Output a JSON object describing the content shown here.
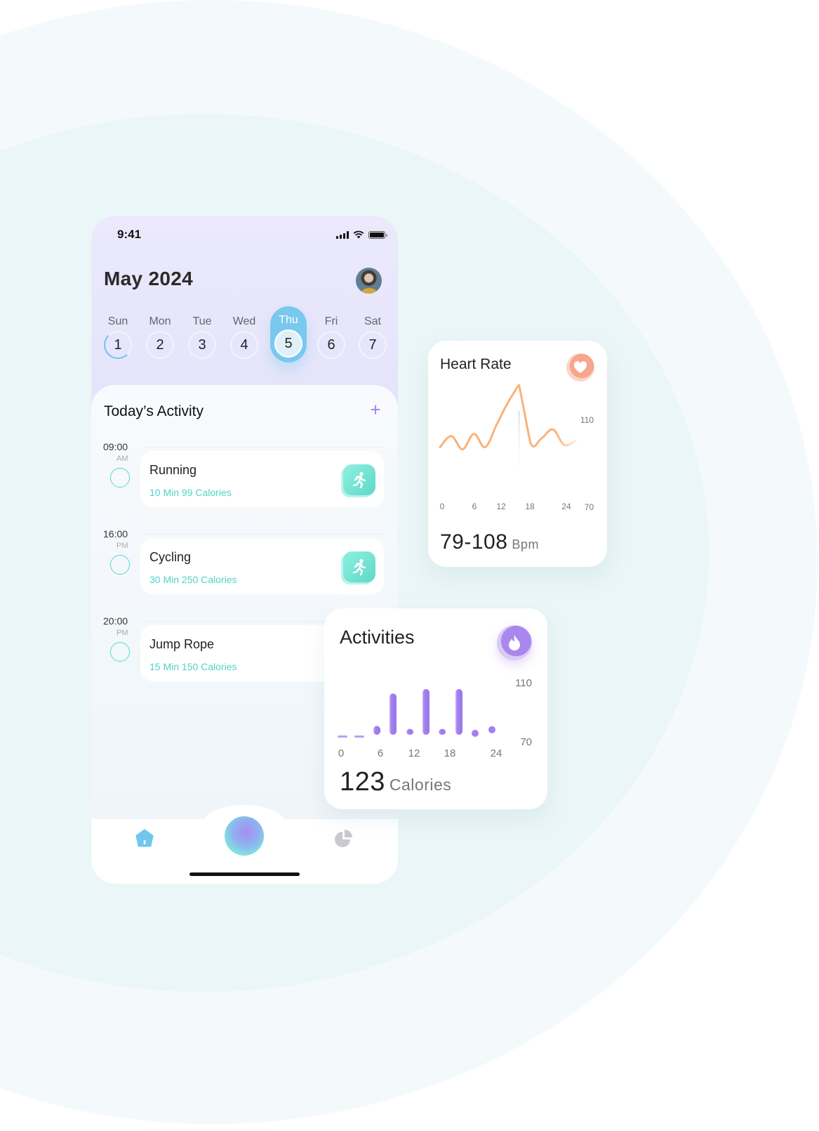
{
  "status_bar": {
    "time": "9:41"
  },
  "header": {
    "month_title": "May 2024"
  },
  "week": {
    "days": [
      {
        "name": "Sun",
        "num": "1",
        "state": "progress"
      },
      {
        "name": "Mon",
        "num": "2",
        "state": "normal"
      },
      {
        "name": "Tue",
        "num": "3",
        "state": "normal"
      },
      {
        "name": "Wed",
        "num": "4",
        "state": "normal"
      },
      {
        "name": "Thu",
        "num": "5",
        "state": "active"
      },
      {
        "name": "Fri",
        "num": "6",
        "state": "normal"
      },
      {
        "name": "Sat",
        "num": "7",
        "state": "normal"
      }
    ]
  },
  "activity": {
    "title": "Today’s Activity",
    "add_label": "+",
    "items": [
      {
        "time": "09:00",
        "ampm": "AM",
        "name": "Running",
        "meta": "10 Min 99 Calories",
        "icon": "running-icon"
      },
      {
        "time": "16:00",
        "ampm": "PM",
        "name": "Cycling",
        "meta": "30 Min 250 Calories",
        "icon": "running-icon"
      },
      {
        "time": "20:00",
        "ampm": "PM",
        "name": "Jump Rope",
        "meta": "15 Min 150 Calories",
        "icon": "none"
      }
    ]
  },
  "tab_bar": {
    "items": [
      "home-icon",
      "center-orb",
      "stats-icon"
    ]
  },
  "heart_rate": {
    "title": "Heart Rate",
    "value": "79-108",
    "unit": "Bpm",
    "color": "#fbb277"
  },
  "activities": {
    "title": "Activities",
    "value": "123",
    "unit": "Calories",
    "color": "#a37ff0"
  },
  "chart_data": [
    {
      "type": "line",
      "title": "Heart Rate",
      "x": [
        0,
        2,
        4,
        6,
        8,
        10,
        12,
        14,
        16,
        18,
        20,
        22,
        24
      ],
      "values": [
        80,
        85,
        79,
        86,
        80,
        90,
        100,
        108,
        82,
        84,
        88,
        81,
        83
      ],
      "xticks": [
        "0",
        "6",
        "12",
        "18",
        "24"
      ],
      "yticks": [
        "110",
        "70"
      ],
      "xlim": [
        0,
        24
      ],
      "ylim": [
        70,
        110
      ],
      "highlight_x": 14
    },
    {
      "type": "bar",
      "title": "Activities",
      "categories": [
        "1",
        "3",
        "5",
        "7",
        "9",
        "11",
        "13",
        "15",
        "17",
        "19",
        "21"
      ],
      "values": [
        70.5,
        70.5,
        76,
        98,
        74,
        101,
        74,
        101,
        71,
        72,
        0
      ],
      "xticks": [
        "0",
        "6",
        "12",
        "18",
        "24"
      ],
      "yticks": [
        "110",
        "70"
      ],
      "xlim": [
        0,
        24
      ],
      "ylim": [
        70,
        110
      ]
    }
  ]
}
